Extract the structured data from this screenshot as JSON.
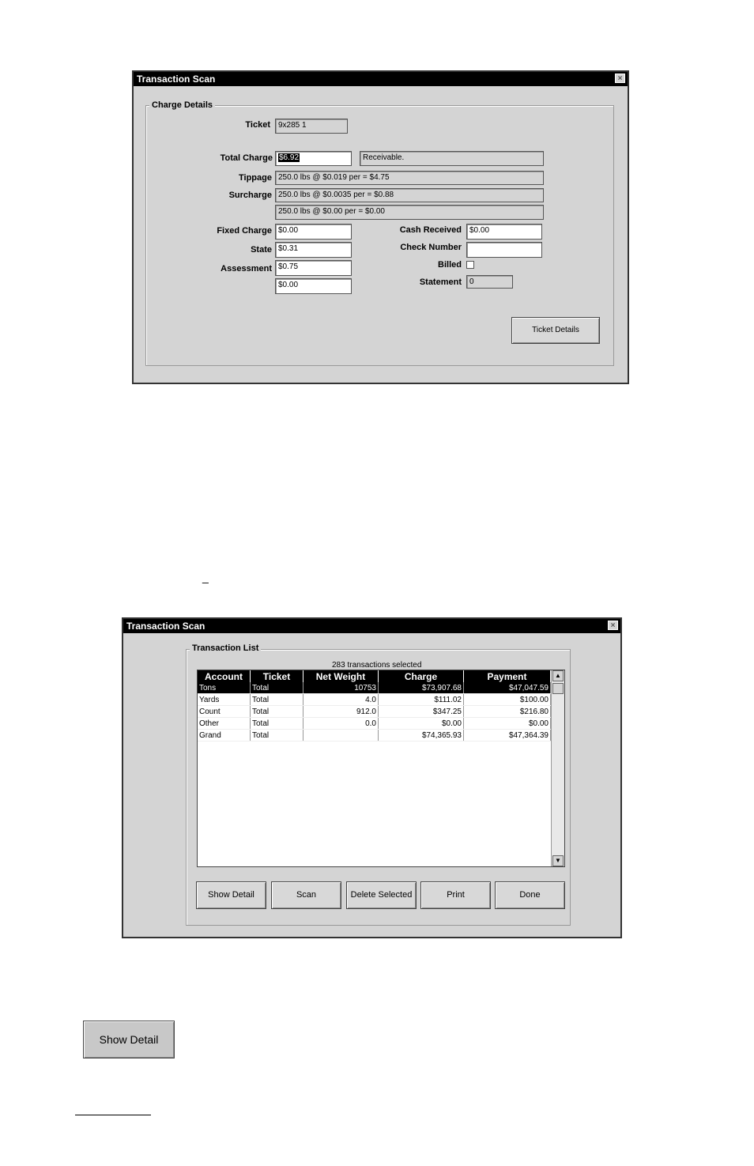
{
  "top_window": {
    "title": "Transaction Scan",
    "close": "×",
    "group_label": "Charge Details",
    "ticket_label": "Ticket",
    "ticket_value": "9x285 1",
    "total_charge_label": "Total Charge",
    "total_charge_value": "$6.92",
    "status_value": "Receivable.",
    "tippage_label": "Tippage",
    "tippage_value": "250.0 lbs @ $0.019 per = $4.75",
    "surcharge_label": "Surcharge",
    "surcharge_value_1": "250.0 lbs @ $0.0035 per = $0.88",
    "surcharge_value_2": "250.0 lbs @ $0.00 per = $0.00",
    "fixed_charge_label": "Fixed Charge",
    "fixed_charge_value": "$0.00",
    "state_label": "State",
    "state_value": "$0.31",
    "assessment_label": "Assessment",
    "assessment_value": "$0.75",
    "extra_value": "$0.00",
    "cash_received_label": "Cash Received",
    "cash_received_value": "$0.00",
    "check_number_label": "Check Number",
    "check_number_value": "",
    "billed_label": "Billed",
    "statement_label": "Statement",
    "statement_value": "0",
    "ticket_details_button": "Ticket Details"
  },
  "mid_mark": "_",
  "bottom_window": {
    "title": "Transaction Scan",
    "close": "×",
    "group_label": "Transaction List",
    "count_text": "283 transactions selected",
    "columns": [
      "Account",
      "Ticket",
      "Net Weight",
      "Charge",
      "Payment"
    ],
    "rows": [
      [
        "Tons",
        "Total",
        "10753",
        "$73,907.68",
        "$47,047.59"
      ],
      [
        "Yards",
        "Total",
        "4.0",
        "$111.02",
        "$100.00"
      ],
      [
        "Count",
        "Total",
        "912.0",
        "$347.25",
        "$216.80"
      ],
      [
        "Other",
        "Total",
        "0.0",
        "$0.00",
        "$0.00"
      ],
      [
        "Grand",
        "Total",
        "",
        "$74,365.93",
        "$47,364.39"
      ]
    ],
    "buttons": [
      "Show Detail",
      "Scan",
      "Delete Selected",
      "Print",
      "Done"
    ]
  },
  "standalone_button": "Show Detail"
}
